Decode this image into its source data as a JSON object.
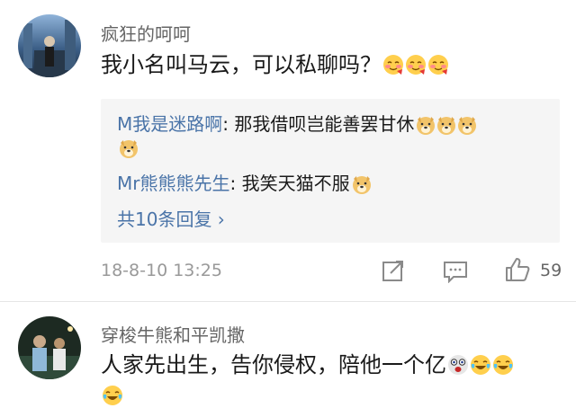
{
  "comments": [
    {
      "username": "疯狂的呵呵",
      "text": "我小名叫马云，可以私聊吗？",
      "emojis": [
        "blush-emoji",
        "blush-emoji",
        "blush-emoji"
      ],
      "replies": [
        {
          "username": "M我是迷路啊",
          "separator": ": ",
          "text": "那我借呗岂能善罢甘休",
          "emojis": [
            "doge-emoji",
            "doge-emoji",
            "doge-emoji",
            "doge-emoji"
          ]
        },
        {
          "username": "Mr熊熊熊先生",
          "separator": ": ",
          "text": "我笑天猫不服",
          "emojis": [
            "doge-emoji"
          ]
        }
      ],
      "more_replies": "共10条回复 ›",
      "timestamp": "18-8-10 13:25",
      "like_count": "59",
      "actions": [
        "share-icon",
        "comment-icon",
        "like-icon"
      ]
    },
    {
      "username": "穿梭牛熊和平凯撒",
      "text": "人家先出生，告你侵权，陪他一个亿",
      "emojis": [
        "shocked-emoji",
        "laugh-cry-emoji",
        "laugh-cry-emoji",
        "laugh-cry-emoji"
      ]
    }
  ],
  "colors": {
    "link_blue": "#4a74a8",
    "meta_gray": "#999999",
    "reply_bg": "#f5f5f5"
  }
}
